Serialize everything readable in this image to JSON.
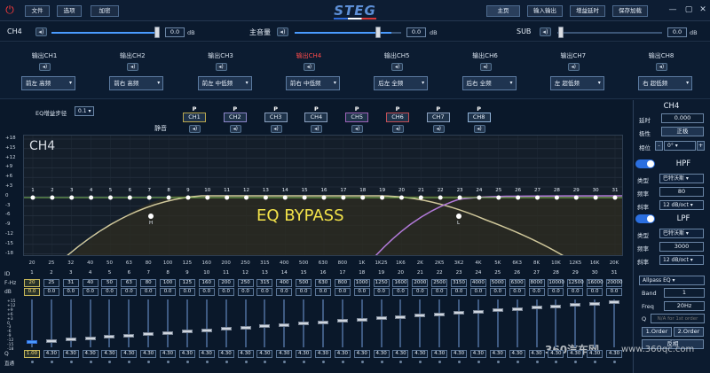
{
  "titlebar": {
    "menu": [
      "文件",
      "选项",
      "加密"
    ],
    "brand": "STEG",
    "nav": [
      "主页",
      "输入输出",
      "增益延时",
      "保存加载"
    ]
  },
  "volume": {
    "left_label": "CH4",
    "left_value": "0.0",
    "left_level": 1.0,
    "master_label": "主音量",
    "master_value": "0.0",
    "master_level": 0.91,
    "sub_label": "SUB",
    "sub_value": "0.0",
    "sub_level": 0.01,
    "unit": "dB"
  },
  "channels": [
    {
      "name": "输出CH1",
      "assign": "前左 高频",
      "active": false
    },
    {
      "name": "输出CH2",
      "assign": "前右 高频",
      "active": false
    },
    {
      "name": "输出CH3",
      "assign": "前左 中低频",
      "active": false
    },
    {
      "name": "输出CH4",
      "assign": "前右 中低频",
      "active": true
    },
    {
      "name": "输出CH5",
      "assign": "后左 全频",
      "active": false
    },
    {
      "name": "输出CH6",
      "assign": "后右 全频",
      "active": false
    },
    {
      "name": "输出CH7",
      "assign": "左 超低频",
      "active": false
    },
    {
      "name": "输出CH8",
      "assign": "右 超低频",
      "active": false
    }
  ],
  "eq": {
    "step_label": "EQ增益步径",
    "step_value": "0.1",
    "mute_label": "静音",
    "link_label": "P",
    "link_buttons": [
      "CH1",
      "CH2",
      "CH3",
      "CH4",
      "CH5",
      "CH6",
      "CH7",
      "CH8"
    ],
    "link_colors": [
      "#b9a64e",
      "#8c86c9",
      "#8aa0bf",
      "#8aa0bf",
      "#9e63b8",
      "#c24f57",
      "#8aa0bf",
      "#8fb1d6"
    ],
    "graph_title": "CH4",
    "bypass_text": "EQ BYPASS",
    "y_ticks": [
      "+18",
      "+15",
      "+12",
      "+9",
      "+6",
      "+3",
      "0",
      "-3",
      "-6",
      "-9",
      "-12",
      "-15",
      "-18"
    ],
    "x_ticks": [
      "20",
      "25",
      "32",
      "40",
      "50",
      "63",
      "80",
      "100",
      "125",
      "160",
      "200",
      "250",
      "315",
      "400",
      "500",
      "630",
      "800",
      "1K",
      "1K25",
      "1K6",
      "2K",
      "2K5",
      "3K2",
      "4K",
      "5K",
      "6K3",
      "8K",
      "10K",
      "12K5",
      "16K",
      "20K"
    ],
    "hp_marker": "H",
    "lp_marker": "L",
    "row_labels": {
      "id": "ID",
      "freq": "F-Hz",
      "gain": "dB",
      "q": "Q"
    },
    "scale_marks": [
      "+15",
      "+12",
      "+9",
      "+6",
      "+3",
      "0",
      "-3",
      "-6",
      "-9",
      "-12",
      "-15",
      "-18"
    ],
    "bypass_row_label": "直通",
    "bands": [
      {
        "id": "1",
        "f": "20",
        "g": "0.0",
        "q": "1.00"
      },
      {
        "id": "2",
        "f": "25",
        "g": "0.0",
        "q": "4.30"
      },
      {
        "id": "3",
        "f": "31",
        "g": "0.0",
        "q": "4.30"
      },
      {
        "id": "4",
        "f": "40",
        "g": "0.0",
        "q": "4.30"
      },
      {
        "id": "5",
        "f": "50",
        "g": "0.0",
        "q": "4.30"
      },
      {
        "id": "6",
        "f": "63",
        "g": "0.0",
        "q": "4.30"
      },
      {
        "id": "7",
        "f": "80",
        "g": "0.0",
        "q": "4.30"
      },
      {
        "id": "8",
        "f": "100",
        "g": "0.0",
        "q": "4.30"
      },
      {
        "id": "9",
        "f": "125",
        "g": "0.0",
        "q": "4.30"
      },
      {
        "id": "10",
        "f": "160",
        "g": "0.0",
        "q": "4.30"
      },
      {
        "id": "11",
        "f": "200",
        "g": "0.0",
        "q": "4.30"
      },
      {
        "id": "12",
        "f": "250",
        "g": "0.0",
        "q": "4.30"
      },
      {
        "id": "13",
        "f": "315",
        "g": "0.0",
        "q": "4.30"
      },
      {
        "id": "14",
        "f": "400",
        "g": "0.0",
        "q": "4.30"
      },
      {
        "id": "15",
        "f": "500",
        "g": "0.0",
        "q": "4.30"
      },
      {
        "id": "16",
        "f": "630",
        "g": "0.0",
        "q": "4.30"
      },
      {
        "id": "17",
        "f": "800",
        "g": "0.0",
        "q": "4.30"
      },
      {
        "id": "18",
        "f": "1000",
        "g": "0.0",
        "q": "4.30"
      },
      {
        "id": "19",
        "f": "1250",
        "g": "0.0",
        "q": "4.30"
      },
      {
        "id": "20",
        "f": "1600",
        "g": "0.0",
        "q": "4.30"
      },
      {
        "id": "21",
        "f": "2000",
        "g": "0.0",
        "q": "4.30"
      },
      {
        "id": "22",
        "f": "2500",
        "g": "0.0",
        "q": "4.30"
      },
      {
        "id": "23",
        "f": "3150",
        "g": "0.0",
        "q": "4.30"
      },
      {
        "id": "24",
        "f": "4000",
        "g": "0.0",
        "q": "4.30"
      },
      {
        "id": "25",
        "f": "5000",
        "g": "0.0",
        "q": "4.30"
      },
      {
        "id": "26",
        "f": "6300",
        "g": "0.0",
        "q": "4.30"
      },
      {
        "id": "27",
        "f": "8000",
        "g": "0.0",
        "q": "4.30"
      },
      {
        "id": "28",
        "f": "10000",
        "g": "0.0",
        "q": "4.30"
      },
      {
        "id": "29",
        "f": "12500",
        "g": "0.0",
        "q": "4.30"
      },
      {
        "id": "30",
        "f": "16000",
        "g": "0.0",
        "q": "4.30"
      },
      {
        "id": "31",
        "f": "20000",
        "g": "0.0",
        "q": "4.30"
      }
    ]
  },
  "right": {
    "title": "CH4",
    "delay_label": "延时",
    "delay_value": "0.000",
    "polarity_label": "极性",
    "polarity_value": "正极",
    "phase_label": "相位",
    "phase_value": "0°",
    "hpf_title": "HPF",
    "hpf_type_label": "类型",
    "hpf_type": "巴特沃斯",
    "hpf_freq_label": "频率",
    "hpf_freq": "80",
    "hpf_slope_label": "斜率",
    "hpf_slope": "12 dB/oct",
    "lpf_title": "LPF",
    "lpf_type_label": "类型",
    "lpf_type": "巴特沃斯",
    "lpf_freq_label": "频率",
    "lpf_freq": "3000",
    "lpf_slope_label": "斜率",
    "lpf_slope": "12 dB/oct",
    "filter_select": "Allpass EQ",
    "band_label": "Band",
    "band_value": "1",
    "freq_label": "Freq",
    "freq_value": "20Hz",
    "q_label": "Q",
    "q_placeholder": "N/A for 1st order",
    "order1": "1.Order",
    "order2": "2.Order",
    "invert": "反相",
    "unit": "dB"
  },
  "watermark": {
    "brand": "360汽车网",
    "url": "www.360qc.com"
  }
}
